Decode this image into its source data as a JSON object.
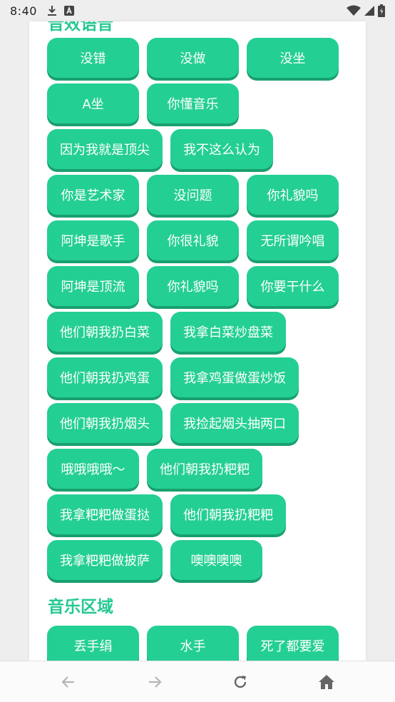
{
  "status_bar": {
    "time": "8:40"
  },
  "sections": {
    "voice_title": "音效语音",
    "music_title": "音乐区域"
  },
  "voice_buttons": [
    "没错",
    "没做",
    "没坐",
    "A坐",
    "你懂音乐",
    "因为我就是顶尖",
    "我不这么认为",
    "你是艺术家",
    "没问题",
    "你礼貌吗",
    "阿坤是歌手",
    "你很礼貌",
    "无所谓吟唱",
    "阿坤是顶流",
    "你礼貌吗",
    "你要干什么",
    "他们朝我扔白菜",
    "我拿白菜炒盘菜",
    "他们朝我扔鸡蛋",
    "我拿鸡蛋做蛋炒饭",
    "他们朝我扔烟头",
    "我捡起烟头抽两口",
    "哦哦哦哦～",
    "他们朝我扔粑粑",
    "我拿粑粑做蛋挞",
    "他们朝我扔粑粑",
    "我拿粑粑做披萨",
    "噢噢噢噢"
  ],
  "music_buttons": [
    "丢手绢",
    "水手",
    "死了都要爱"
  ],
  "colors": {
    "accent": "#24cf93",
    "accent_shadow": "#19a06f",
    "title": "#24c98f"
  },
  "nav_icons": [
    "back-arrow-icon",
    "forward-arrow-icon",
    "refresh-icon",
    "home-icon"
  ]
}
